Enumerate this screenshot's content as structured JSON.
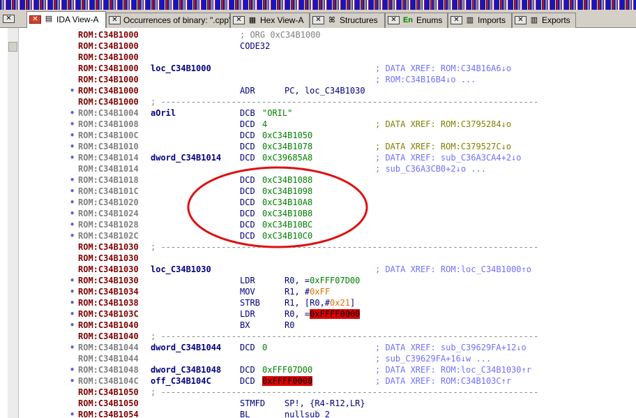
{
  "tabs": [
    {
      "label": "IDA View-A",
      "icon": "document-icon",
      "active": true
    },
    {
      "label": "Occurrences of binary: \".cpp\"",
      "icon": "",
      "active": false
    },
    {
      "label": "Hex View-A",
      "icon": "hex-icon",
      "active": false
    },
    {
      "label": "Structures",
      "icon": "structures-icon",
      "active": false
    },
    {
      "label": "Enums",
      "icon": "enums-icon",
      "icon_text": "En",
      "active": false
    },
    {
      "label": "Imports",
      "icon": "imports-icon",
      "active": false
    },
    {
      "label": "Exports",
      "icon": "exports-icon",
      "active": false
    }
  ],
  "tab_close_glyph": "✕",
  "colors": {
    "navigator_base": "#1515c8",
    "code_address": "#800000",
    "data_address": "#808080",
    "comment": "#7070ff",
    "highlight_red": "#e00000",
    "annotation_circle": "#e01010"
  },
  "disassembly": [
    {
      "dot": "",
      "addr": "ROM:C34B1000",
      "kind": "code",
      "label": "",
      "mnem": "; ORG 0xC34B1000",
      "ops": "",
      "comment": ""
    },
    {
      "dot": "",
      "addr": "ROM:C34B1000",
      "kind": "code",
      "label": "",
      "mnem": "CODE32",
      "ops": "",
      "comment": ""
    },
    {
      "dot": "",
      "addr": "ROM:C34B1000",
      "kind": "code",
      "label": "",
      "mnem": "",
      "ops": "",
      "comment": ""
    },
    {
      "dot": "",
      "addr": "ROM:C34B1000",
      "kind": "code",
      "label": "loc_C34B1000",
      "mnem": "",
      "ops": "",
      "comment": "; DATA XREF: ROM:C34B16A6↓o"
    },
    {
      "dot": "",
      "addr": "ROM:C34B1000",
      "kind": "code",
      "label": "",
      "mnem": "",
      "ops": "",
      "comment": "; ROM:C34B16B4↓o ..."
    },
    {
      "dot": "•",
      "addr": "ROM:C34B1000",
      "kind": "code",
      "label": "",
      "mnem": "ADR",
      "ops": "PC, loc_C34B1030",
      "comment": ""
    },
    {
      "dot": "",
      "addr": "ROM:C34B1000",
      "kind": "code",
      "sep": "; ---------------------------------------------------------------------------"
    },
    {
      "dot": "•",
      "addr": "ROM:C34B1004",
      "kind": "data",
      "label": "aOril",
      "mnem": "DCB",
      "ops": "\"ORIL\"",
      "comment": ""
    },
    {
      "dot": "•",
      "addr": "ROM:C34B1008",
      "kind": "data",
      "label": "",
      "mnem": "DCD",
      "ops": "4",
      "comment": "; DATA XREF: ROM:C3795284↓o",
      "comment_alt": true
    },
    {
      "dot": "•",
      "addr": "ROM:C34B100C",
      "kind": "data",
      "label": "",
      "mnem": "DCD",
      "ops": "0xC34B1050",
      "comment": ""
    },
    {
      "dot": "•",
      "addr": "ROM:C34B1010",
      "kind": "data",
      "label": "",
      "mnem": "DCD",
      "ops": "0xC34B1078",
      "comment": "; DATA XREF: ROM:C379527C↓o",
      "comment_alt": true
    },
    {
      "dot": "•",
      "addr": "ROM:C34B1014",
      "kind": "data",
      "label": "dword_C34B1014",
      "mnem": "DCD",
      "ops": "0xC39685A8",
      "comment": "; DATA XREF: sub_C36A3CA4+2↓o"
    },
    {
      "dot": "",
      "addr": "ROM:C34B1014",
      "kind": "data",
      "label": "",
      "mnem": "",
      "ops": "",
      "comment": "; sub_C36A3CB0+2↓o ..."
    },
    {
      "dot": "•",
      "addr": "ROM:C34B1018",
      "kind": "data",
      "label": "",
      "mnem": "DCD",
      "ops": "0xC34B1088",
      "comment": ""
    },
    {
      "dot": "•",
      "addr": "ROM:C34B101C",
      "kind": "data",
      "label": "",
      "mnem": "DCD",
      "ops": "0xC34B1098",
      "comment": ""
    },
    {
      "dot": "•",
      "addr": "ROM:C34B1020",
      "kind": "data",
      "label": "",
      "mnem": "DCD",
      "ops": "0xC34B10A8",
      "comment": ""
    },
    {
      "dot": "•",
      "addr": "ROM:C34B1024",
      "kind": "data",
      "label": "",
      "mnem": "DCD",
      "ops": "0xC34B10B8",
      "comment": ""
    },
    {
      "dot": "•",
      "addr": "ROM:C34B1028",
      "kind": "data",
      "label": "",
      "mnem": "DCD",
      "ops": "0xC34B10BC",
      "comment": ""
    },
    {
      "dot": "•",
      "addr": "ROM:C34B102C",
      "kind": "data",
      "label": "",
      "mnem": "DCD",
      "ops": "0xC34B10C0",
      "comment": ""
    },
    {
      "dot": "",
      "addr": "ROM:C34B1030",
      "kind": "code",
      "sep": "; ---------------------------------------------------------------------------"
    },
    {
      "dot": "",
      "addr": "ROM:C34B1030",
      "kind": "code",
      "label": "",
      "mnem": "",
      "ops": "",
      "comment": ""
    },
    {
      "dot": "",
      "addr": "ROM:C34B1030",
      "kind": "code",
      "label": "loc_C34B1030",
      "mnem": "",
      "ops": "",
      "comment": "; DATA XREF: ROM:loc_C34B1000↑o"
    },
    {
      "dot": "•",
      "addr": "ROM:C34B1030",
      "kind": "code",
      "label": "",
      "mnem": "LDR",
      "ops": "R0, =0xFFF07D00",
      "comment": ""
    },
    {
      "dot": "•",
      "addr": "ROM:C34B1034",
      "kind": "code",
      "label": "",
      "mnem": "MOV",
      "ops": "R1, #0xFF",
      "comment": ""
    },
    {
      "dot": "•",
      "addr": "ROM:C34B1038",
      "kind": "code",
      "label": "",
      "mnem": "STRB",
      "ops": "R1, [R0,#0x21]",
      "comment": ""
    },
    {
      "dot": "•",
      "addr": "ROM:C34B103C",
      "kind": "code",
      "label": "",
      "mnem": "LDR",
      "ops": "R0, =0xFFFF0000",
      "comment": ""
    },
    {
      "dot": "•",
      "addr": "ROM:C34B1040",
      "kind": "code",
      "label": "",
      "mnem": "BX",
      "ops": "R0",
      "comment": ""
    },
    {
      "dot": "",
      "addr": "ROM:C34B1040",
      "kind": "code",
      "sep": "; ---------------------------------------------------------------------------"
    },
    {
      "dot": "•",
      "addr": "ROM:C34B1044",
      "kind": "data",
      "label": "dword_C34B1044",
      "mnem": "DCD",
      "ops": "0",
      "comment": "; DATA XREF: sub_C39629FA+12↓o"
    },
    {
      "dot": "",
      "addr": "ROM:C34B1044",
      "kind": "data",
      "label": "",
      "mnem": "",
      "ops": "",
      "comment": "; sub_C39629FA+16↓w ..."
    },
    {
      "dot": "•",
      "addr": "ROM:C34B1048",
      "kind": "data",
      "label": "dword_C34B1048",
      "mnem": "DCD",
      "ops": "0xFFF07D00",
      "comment": "; DATA XREF: ROM:loc_C34B1030↑r"
    },
    {
      "dot": "•",
      "addr": "ROM:C34B104C",
      "kind": "data",
      "label": "off_C34B104C",
      "mnem": "DCD",
      "ops": "0xFFFF0000",
      "comment": "; DATA XREF: ROM:C34B103C↑r"
    },
    {
      "dot": "",
      "addr": "ROM:C34B1050",
      "kind": "code",
      "sep": "; ---------------------------------------------------------------------------"
    },
    {
      "dot": "",
      "addr": "ROM:C34B1050",
      "kind": "code",
      "label": "",
      "mnem": "STMFD",
      "ops": "SP!, {R4-R12,LR}",
      "comment": ""
    },
    {
      "dot": "•",
      "addr": "ROM:C34B1054",
      "kind": "code",
      "label": "",
      "mnem": "BL",
      "ops": "nullsub_2",
      "comment": ""
    }
  ]
}
